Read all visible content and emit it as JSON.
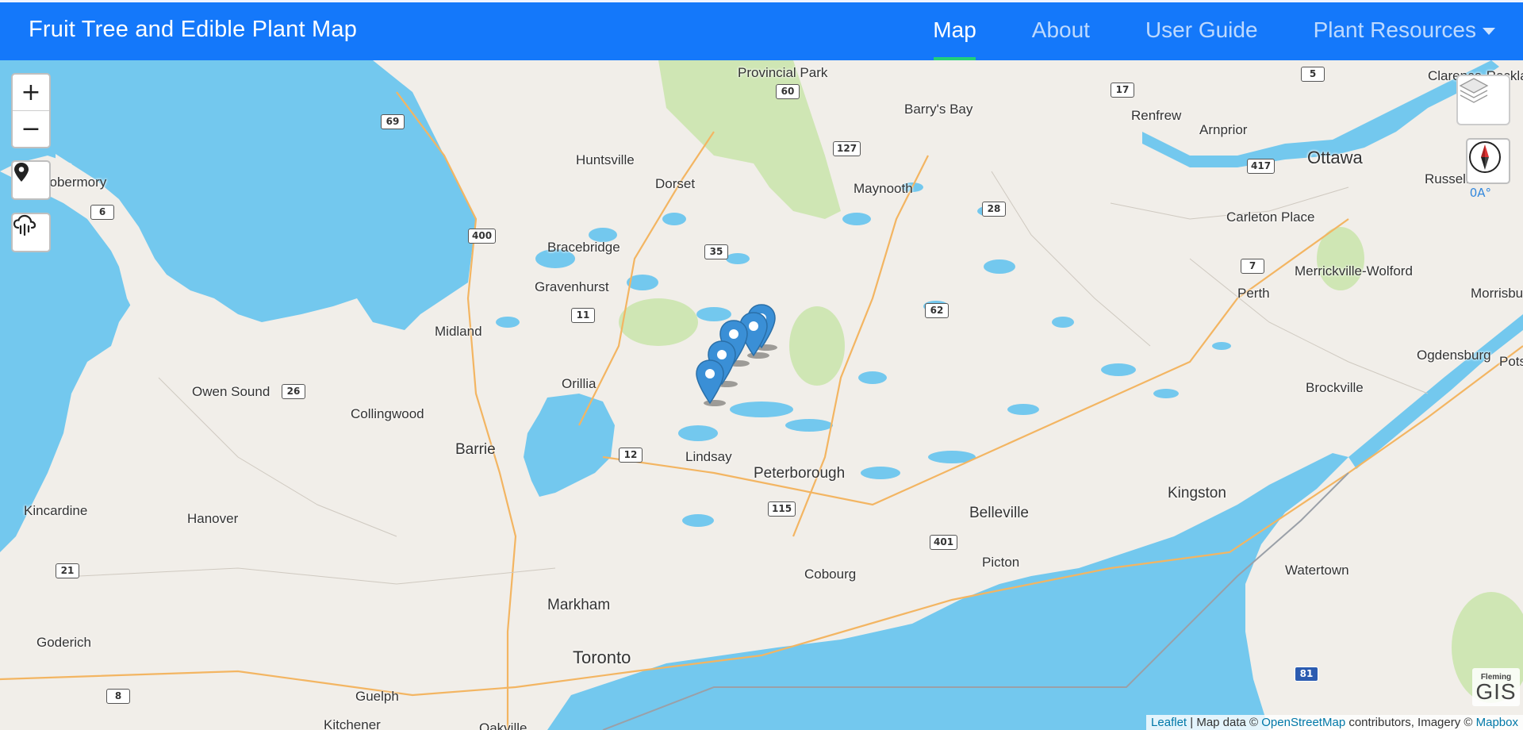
{
  "app": {
    "title": "Fruit Tree and Edible Plant Map"
  },
  "nav": {
    "items": [
      {
        "label": "Map",
        "active": true
      },
      {
        "label": "About"
      },
      {
        "label": "User Guide"
      },
      {
        "label": "Plant Resources",
        "dropdown": true
      }
    ]
  },
  "controls": {
    "zoom_in": "+",
    "zoom_out": "−",
    "locate_icon": "map-pin-icon",
    "weather_icon": "cloud-rain-icon",
    "layers_icon": "layers-icon",
    "compass_icon": "compass-icon",
    "compass_label": "0A°"
  },
  "map": {
    "place_labels": [
      "Provincial Park",
      "Barry's Bay",
      "Renfrew",
      "Arnprior",
      "Ottawa",
      "Clarence-Rockland",
      "Russell",
      "Huntsville",
      "Dorset",
      "Maynooth",
      "Carleton Place",
      "Tobermory",
      "Bracebridge",
      "Gravenhurst",
      "Merrickville-Wolford",
      "Perth",
      "Morrisburg",
      "Midland",
      "Ogdensburg",
      "Orillia",
      "Owen Sound",
      "Brockville",
      "Collingwood",
      "Barrie",
      "Lindsay",
      "Peterborough",
      "Kingston",
      "Belleville",
      "Kincardine",
      "Hanover",
      "Picton",
      "Cobourg",
      "Watertown",
      "Markham",
      "Goderich",
      "Toronto",
      "Guelph",
      "Kitchener",
      "Oakville",
      "Potsdam"
    ],
    "route_shields": [
      "60",
      "5",
      "17",
      "69",
      "127",
      "417",
      "6",
      "400",
      "35",
      "28",
      "7",
      "62",
      "11",
      "26",
      "12",
      "115",
      "401",
      "21",
      "8",
      "81",
      "Fleming"
    ],
    "markers_count": 5,
    "colors": {
      "water": "#73c8ee",
      "land": "#f1eee9",
      "park": "#cfe6b4",
      "marker": "#3a8fd6",
      "nav": "#1478fa",
      "active_underline": "#22d07a"
    }
  },
  "attribution": {
    "leaflet": "Leaflet",
    "sep1": " | Map data © ",
    "osm": "OpenStreetMap",
    "mid": " contributors, Imagery © ",
    "mapbox": "Mapbox"
  },
  "logo": {
    "small": "Fleming",
    "big": "GIS"
  }
}
